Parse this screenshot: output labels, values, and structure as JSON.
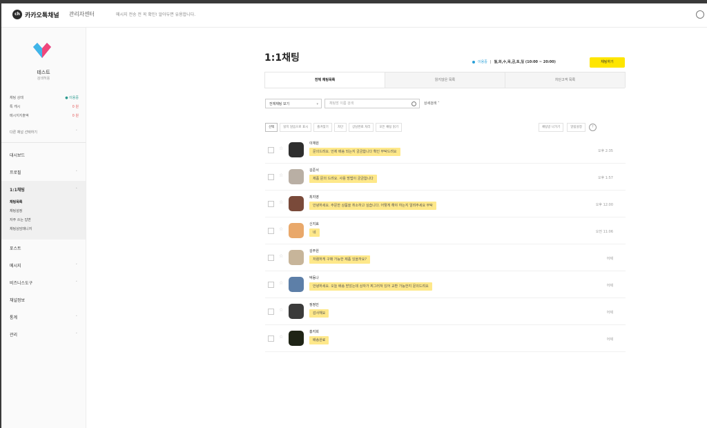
{
  "header": {
    "logo_text": "ch",
    "brand": "카카오톡채널",
    "brand_sub": "관리자센터",
    "notice": "메시지 전송 전 꼭 확인! 알아두면 유용합니다."
  },
  "sidebar": {
    "profile_name": "테스트",
    "profile_sub": "검색허용",
    "stats": [
      {
        "label": "채팅 상태",
        "value": "● 이용중",
        "tone": "green"
      },
      {
        "label": "톡 캐시",
        "value": "0 원",
        "tone": "red"
      },
      {
        "label": "메시지지출액",
        "value": "0 원",
        "tone": "red"
      }
    ],
    "channel_select": "다른 채널 선택하기",
    "menu": [
      {
        "label": "대시보드",
        "caret": ""
      },
      {
        "label": "프로필",
        "caret": "˅"
      },
      {
        "label": "1:1채팅",
        "caret": "˄",
        "active": true
      },
      {
        "label": "포스트",
        "caret": ""
      },
      {
        "label": "메시지",
        "caret": "˅"
      },
      {
        "label": "비즈니스도구",
        "caret": "˅"
      },
      {
        "label": "채널정보",
        "caret": ""
      },
      {
        "label": "통계",
        "caret": "˅"
      },
      {
        "label": "관리",
        "caret": "˅"
      }
    ],
    "submenu": [
      "채팅목록",
      "채팅설정",
      "자주 쓰는 답변",
      "채팅상담매니저"
    ]
  },
  "main": {
    "title": "1:1채팅",
    "status_on": "이용중",
    "hours": "월,화,수,목,금,토,일 (10:00 ~ 20:00)",
    "available_button": "채팅하기",
    "tabs": [
      "전체 채팅목록",
      "읽지않은 목록",
      "차단고객 목록"
    ],
    "filter_select": "전체채팅 보기",
    "search_placeholder": "채팅방 이름 검색",
    "detail_search": "상세검색",
    "actions": [
      "선택",
      "읽지 않음으로 표시",
      "즐겨찾기",
      "차단",
      "상담완료 처리",
      "모든 채팅 읽기"
    ],
    "actions_right": [
      "채팅방 나가기",
      "알림설정"
    ],
    "help": "?"
  },
  "chats": [
    {
      "name": "이재원",
      "message": "문의드려요. 언제 배송 되는지 궁금합니다 확인 부탁드려요",
      "time": "오후 2:35",
      "avatar_color": "#2e2e2e"
    },
    {
      "name": "김준서",
      "message": "제품 문의 드려요. 사용 방법이 궁금합니다",
      "time": "오후 1:57",
      "avatar_color": "#b9afa4"
    },
    {
      "name": "최지영",
      "message": "안녕하세요. 주문한 상품을 취소하고 싶습니다. 어떻게 해야 하는지 알려주세요 부탁",
      "time": "오후 12:00",
      "avatar_color": "#7a4a3a"
    },
    {
      "name": "신지효",
      "message": "네",
      "time": "오전 11:06",
      "avatar_color": "#e9a86a"
    },
    {
      "name": "김주원",
      "message": "저렴하게 구매 가능한 제품 있을까요?",
      "time": "어제",
      "avatar_color": "#c7b59a"
    },
    {
      "name": "박동나",
      "message": "안녕하세요. 오늘 배송 받았는데 상자가 찌그러져 있어 교환 가능한지 문의드려요",
      "time": "어제",
      "avatar_color": "#5d7fa8"
    },
    {
      "name": "정정민",
      "message": "감사해요",
      "time": "어제",
      "avatar_color": "#3b3b3b"
    },
    {
      "name": "홍지희",
      "message": "배송완료",
      "time": "어제",
      "avatar_color": "#1f2416"
    }
  ]
}
